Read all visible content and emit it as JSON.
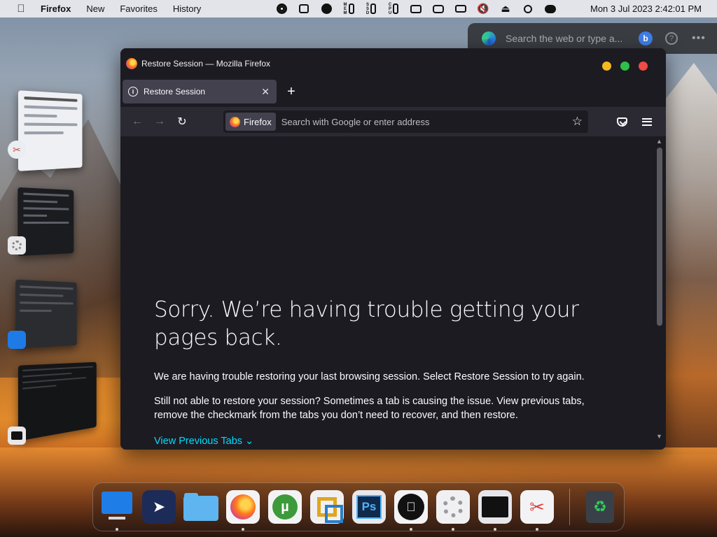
{
  "menubar": {
    "app_name": "Firefox",
    "menus": [
      "New",
      "Favorites",
      "History"
    ],
    "clock": "Mon 3 Jul 2023  2:42:01 PM",
    "status_icons": [
      "record-icon",
      "notes-icon",
      "eject-disk-icon",
      "mem-gauge-icon",
      "ssd-gauge-icon",
      "cpu-gauge-icon",
      "battery-icon",
      "display-icon",
      "cast-icon",
      "mute-icon",
      "eject-icon",
      "search-icon",
      "control-center-icon"
    ]
  },
  "edge_bar": {
    "placeholder": "Search the web or type a...",
    "bing_label": "b",
    "help_label": "?",
    "more_label": "•••"
  },
  "window": {
    "title": "Restore Session — Mozilla Firefox",
    "controls": [
      "minimize",
      "maximize",
      "close"
    ]
  },
  "tabs": [
    {
      "label": "Restore Session",
      "close": "✕"
    }
  ],
  "new_tab_label": "+",
  "navbar": {
    "back": "←",
    "forward": "→",
    "reload": "↻",
    "identity_label": "Firefox",
    "url_placeholder": "Search with Google or enter address",
    "bookmark_star": "☆"
  },
  "page": {
    "heading": "Sorry. We’re having trouble getting your pages back.",
    "para1": "We are having trouble restoring your last browsing session. Select Restore Session to try again.",
    "para2": "Still not able to restore your session? Sometimes a tab is causing the issue. View previous tabs, remove the checkmark from the tabs you don’t need to recover, and then restore.",
    "link": "View Previous Tabs ⌄"
  },
  "dock": {
    "apps": [
      "Finder",
      "Launchpad",
      "Files",
      "Firefox",
      "uTorrent",
      "VirtualBox",
      "Photoshop",
      "Apple",
      "Settings",
      "Terminal",
      "Snipping Tool",
      "Recycle Bin"
    ],
    "ps_label": "Ps",
    "utorrent_label": "µ",
    "apple_glyph": "",
    "trash_glyph": "♻"
  }
}
